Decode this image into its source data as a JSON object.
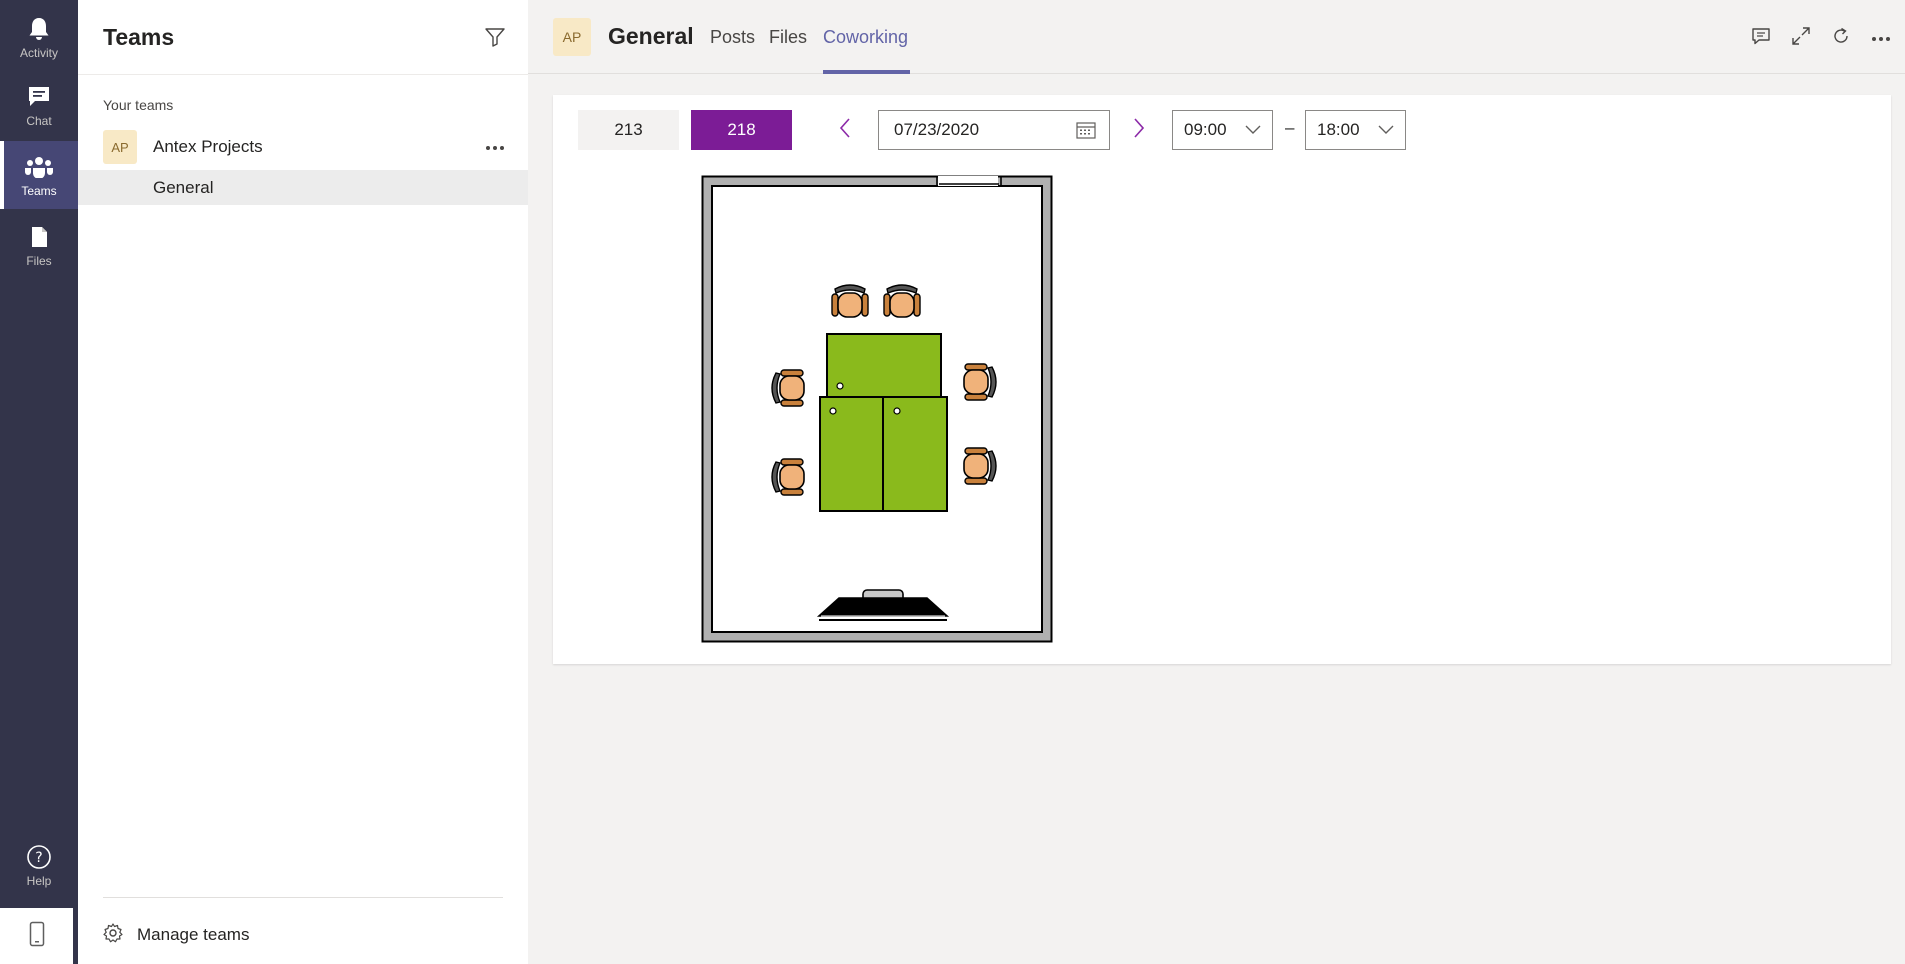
{
  "rail": {
    "items": [
      {
        "label": "Activity",
        "icon": "bell-icon"
      },
      {
        "label": "Chat",
        "icon": "chat-icon"
      },
      {
        "label": "Teams",
        "icon": "teams-icon",
        "active": true
      },
      {
        "label": "Files",
        "icon": "file-icon"
      }
    ],
    "help_label": "Help",
    "device_icon": "mobile-icon"
  },
  "teams_panel": {
    "title": "Teams",
    "section_label": "Your teams",
    "team": {
      "initials": "AP",
      "name": "Antex Projects"
    },
    "channel": {
      "name": "General"
    },
    "manage_label": "Manage teams"
  },
  "header": {
    "avatar_initials": "AP",
    "title": "General",
    "tabs": [
      {
        "label": "Posts"
      },
      {
        "label": "Files"
      },
      {
        "label": "Coworking",
        "active": true
      }
    ]
  },
  "booking": {
    "rooms": [
      {
        "label": "213",
        "selected": false
      },
      {
        "label": "218",
        "selected": true
      }
    ],
    "date": "07/23/2020",
    "start_time": "09:00",
    "separator": "–",
    "end_time": "18:00"
  },
  "colors": {
    "accent": "#6264a7",
    "room_selected": "#7c1c96",
    "rail": "#33344a",
    "desk": "#8aba1c",
    "chair": "#f0b27a"
  }
}
